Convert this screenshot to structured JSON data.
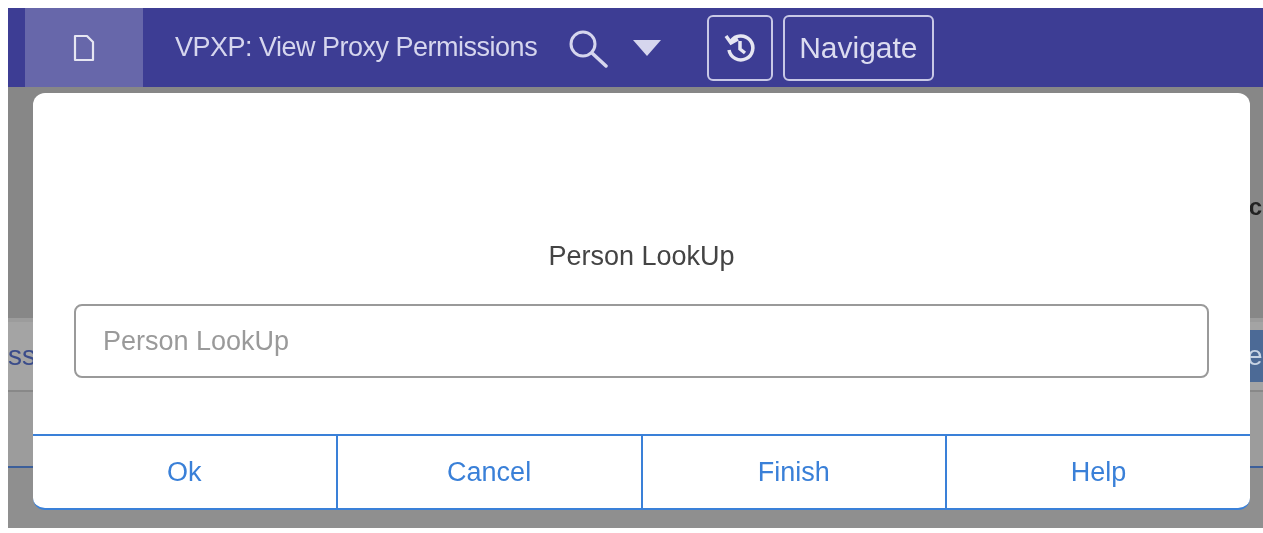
{
  "header": {
    "title": "VPXP: View Proxy Permissions",
    "navigate_label": "Navigate"
  },
  "background": {
    "top_fragment": "c",
    "left_fragment": "ss",
    "right_fragment": "e"
  },
  "dialog": {
    "title": "Person LookUp",
    "field": {
      "placeholder": "Person LookUp"
    },
    "buttons": [
      "Ok",
      "Cancel",
      "Finish",
      "Help"
    ]
  }
}
